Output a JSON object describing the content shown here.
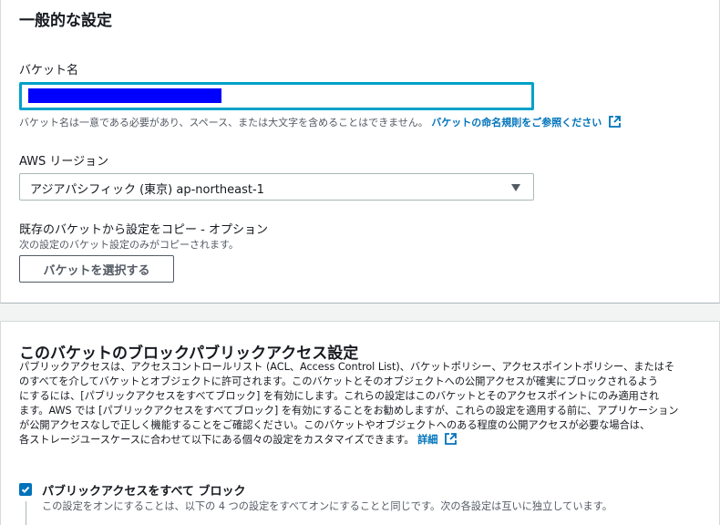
{
  "general": {
    "title": "一般的な設定",
    "bucket_name_label": "バケット名",
    "bucket_name_hint": "バケット名は一意である必要があり、スペース、または大文字を含めることはできません。",
    "bucket_name_link": "バケットの命名規則をご参照ください",
    "region_label": "AWS リージョン",
    "region_value": "アジアパシフィック (東京) ap-northeast-1",
    "copy_label": "既存のバケットから設定をコピー - オプション",
    "copy_hint": "次の設定のバケット設定のみがコピーされます。",
    "choose_bucket_button": "バケットを選択する"
  },
  "block_public": {
    "title": "このバケットのブロックパブリックアクセス設定",
    "description_lines": [
      "パブリックアクセスは、アクセスコントロールリスト (ACL、Access Control List)、バケットポリシー、アクセスポイントポリシー、またはそ",
      "のすべてを介してバケットとオブジェクトに許可されます。このバケットとそのオブジェクトへの公開アクセスが確実にブロックされるよう",
      "にするには、[パブリックアクセスをすべてブロック] を有効にします。これらの設定はこのバケットとそのアクセスポイントにのみ適用され",
      "ます。AWS では [パブリックアクセスをすべてブロック] を有効にすることをお勧めしますが、これらの設定を適用する前に、アプリケーション",
      "が公開アクセスなしで正しく機能することをご確認ください。このバケットやオブジェクトへのある程度の公開アクセスが必要な場合は、",
      "各ストレージユースケースに合わせて以下にある個々の設定をカスタマイズできます。"
    ],
    "learn_more_link": "詳細",
    "block_all_label": "パブリックアクセスをすべて ブロック",
    "block_all_checked": true,
    "block_all_desc": "この設定をオンにすることは、以下の 4 つの設定をすべてオンにすることと同じです。次の各設定は互いに独立しています。"
  },
  "colors": {
    "link": "#0073bb",
    "focus_border": "#00a1c9",
    "redaction": "#0000ff"
  }
}
